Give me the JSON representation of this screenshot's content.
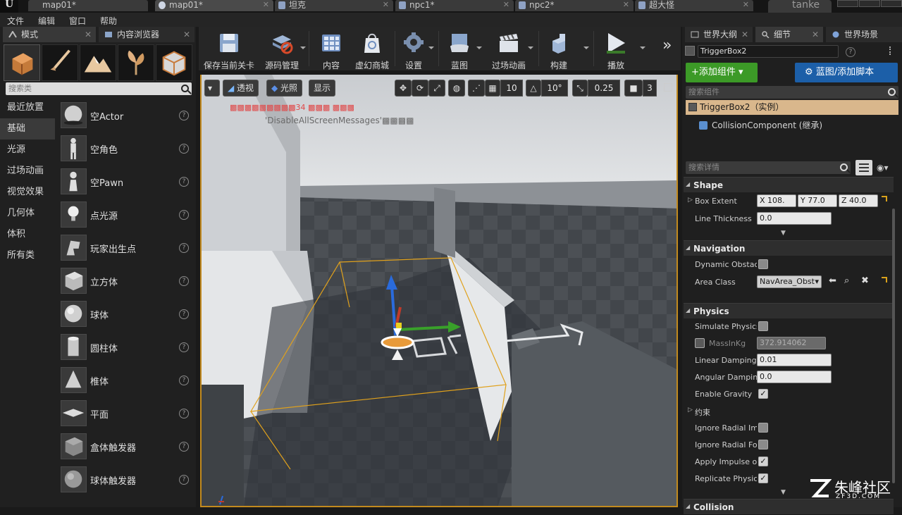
{
  "titlebar": {
    "tabs": [
      {
        "label": "map01*"
      },
      {
        "label": "map01*"
      },
      {
        "label": "坦克"
      },
      {
        "label": "npc1*"
      },
      {
        "label": "npc2*"
      },
      {
        "label": "超大怪"
      }
    ],
    "user": "tanke"
  },
  "menu": [
    "文件",
    "编辑",
    "窗口",
    "帮助"
  ],
  "left_tabs": {
    "modes": "模式",
    "content_browser": "内容浏览器"
  },
  "left_search": "搜索类",
  "categories": [
    "最近放置",
    "基础",
    "光源",
    "过场动画",
    "视觉效果",
    "几何体",
    "体积",
    "所有类"
  ],
  "active_category": "基础",
  "place_items": [
    "空Actor",
    "空角色",
    "空Pawn",
    "点光源",
    "玩家出生点",
    "立方体",
    "球体",
    "圆柱体",
    "椎体",
    "平面",
    "盒体触发器",
    "球体触发器"
  ],
  "toolbar": {
    "buttons": [
      "保存当前关卡",
      "源码管理",
      "内容",
      "虚幻商城",
      "设置",
      "蓝图",
      "过场动画",
      "构建",
      "播放"
    ],
    "more": "»"
  },
  "viewport": {
    "perspective": "透视",
    "lit": "光照",
    "show": "显示",
    "grid_snap": "10",
    "rot_snap": "10°",
    "scale_snap": "0.25",
    "cam_speed": "3",
    "warn_line1_prefix": "▩▩▩▩▩▩▩▩▩",
    "warn_line1_num": "34",
    "warn_line1_suffix": "▩▩▩ ▩▩▩",
    "warn_line2": "'DisableAllScreenMessages'▩▩▩▩"
  },
  "right_tabs": {
    "outliner": "世界大纲",
    "details": "细节",
    "world_settings": "世界场景"
  },
  "details": {
    "actor_name": "TriggerBox2",
    "add_component": "+添加组件",
    "blueprint_add": "蓝图/添加脚本",
    "search_components": "搜索组件",
    "instance_row": "TriggerBox2（实例）",
    "component_row": "CollisionComponent (继承)",
    "search_details": "搜索详情",
    "sections": {
      "shape": "Shape",
      "navigation": "Navigation",
      "physics": "Physics",
      "collision": "Collision"
    },
    "box_extent_label": "Box Extent",
    "box_extent": {
      "x": "X  108.",
      "y": "Y  77.0",
      "z": "Z  40.0"
    },
    "line_thickness_label": "Line Thickness",
    "line_thickness": "0.0",
    "dynamic_obstacle_label": "Dynamic Obstacl",
    "area_class_label": "Area Class",
    "area_class": "NavArea_Obst",
    "simulate_physics_label": "Simulate Physics",
    "mass_label": "MassInKg",
    "mass_value": "372.914062",
    "linear_damping_label": "Linear Damping",
    "linear_damping": "0.01",
    "angular_damping_label": "Angular Damping",
    "angular_damping": "0.0",
    "enable_gravity_label": "Enable Gravity",
    "constraints_label": "约束",
    "ignore_radial_imp_label": "Ignore Radial Imp",
    "ignore_radial_force_label": "Ignore Radial For",
    "apply_impulse_label": "Apply Impulse on",
    "replicate_physics_label": "Replicate Physics",
    "checks": {
      "dynamic_obstacle": false,
      "simulate_physics": false,
      "enable_gravity": true,
      "ignore_radial_imp": false,
      "ignore_radial_force": false,
      "apply_impulse": true,
      "replicate_physics": true
    }
  },
  "watermark": {
    "brand": "朱峰社区",
    "url": "ZF3D.COM"
  },
  "colors": {
    "accent_orange": "#c28a1e",
    "add_green": "#3c9a27",
    "blueprint_blue": "#1c5fa8",
    "selected_row": "#d9b78c"
  }
}
